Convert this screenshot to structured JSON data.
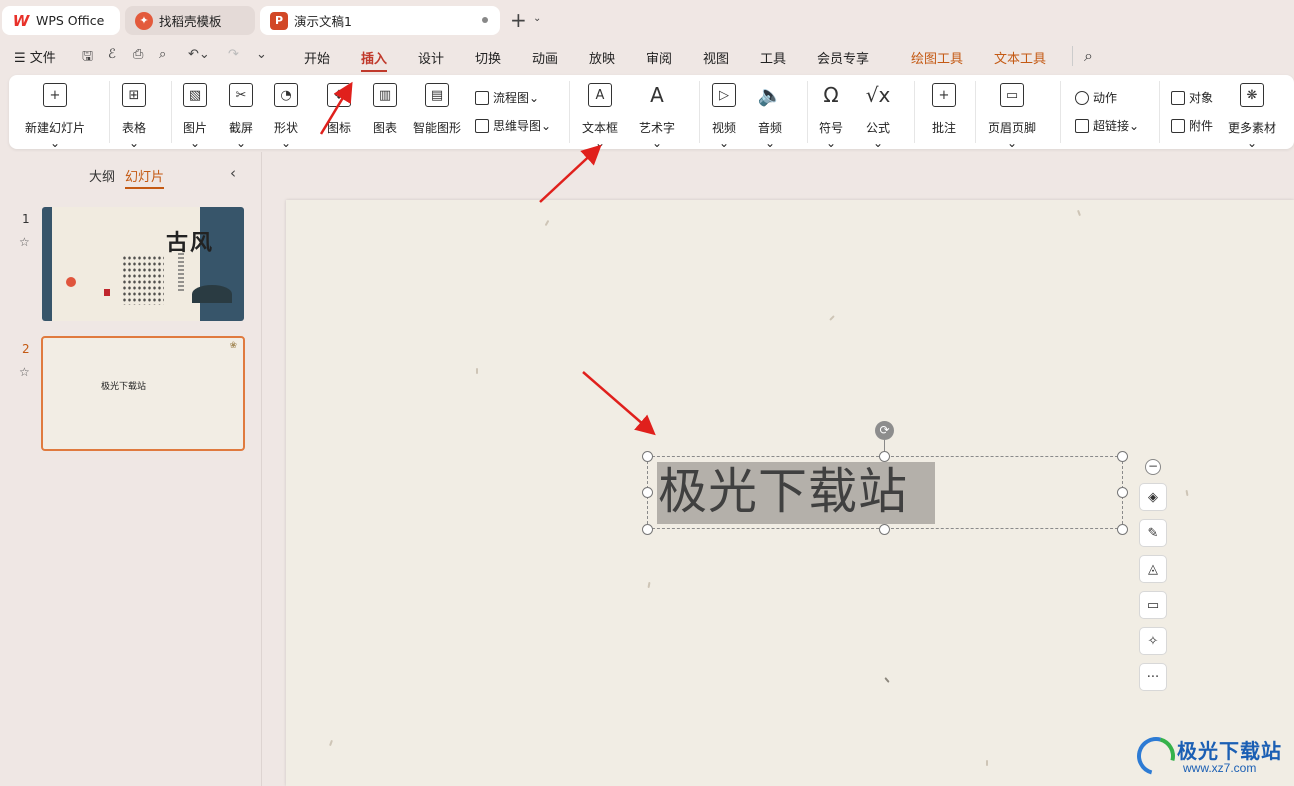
{
  "tabs": [
    {
      "label": "WPS Office",
      "icon": "wps-logo-icon"
    },
    {
      "label": "找稻壳模板",
      "icon": "daoke-icon"
    },
    {
      "label": "演示文稿1",
      "icon": "presentation-icon"
    }
  ],
  "menu": {
    "file": "文件",
    "items": [
      "开始",
      "插入",
      "设计",
      "切换",
      "动画",
      "放映",
      "审阅",
      "视图",
      "工具",
      "会员专享"
    ],
    "active": "插入",
    "context_items": [
      "绘图工具",
      "文本工具"
    ]
  },
  "ribbon": {
    "new_slide": "新建幻灯片",
    "table": "表格",
    "picture": "图片",
    "screenshot": "截屏",
    "shape": "形状",
    "icon": "图标",
    "chart": "图表",
    "smartart": "智能图形",
    "flowchart": "流程图",
    "mindmap": "思维导图",
    "textbox": "文本框",
    "wordart": "艺术字",
    "video": "视频",
    "audio": "音频",
    "symbol": "符号",
    "formula": "公式",
    "comment": "批注",
    "header_footer": "页眉页脚",
    "action": "动作",
    "hyperlink": "超链接",
    "object": "对象",
    "attachment": "附件",
    "more": "更多素材"
  },
  "left_panel": {
    "tab_outline": "大纲",
    "tab_slides": "幻灯片",
    "slides": [
      {
        "number": "1",
        "title": "古风"
      },
      {
        "number": "2",
        "title": "极光下载站"
      }
    ]
  },
  "slide": {
    "text": "极光下载站"
  },
  "watermark": {
    "name": "极光下载站",
    "url": "www.xz7.com"
  },
  "colors": {
    "accent": "#c0392b",
    "context_tab": "#c45a14",
    "annotation_arrow": "#e0201c"
  }
}
